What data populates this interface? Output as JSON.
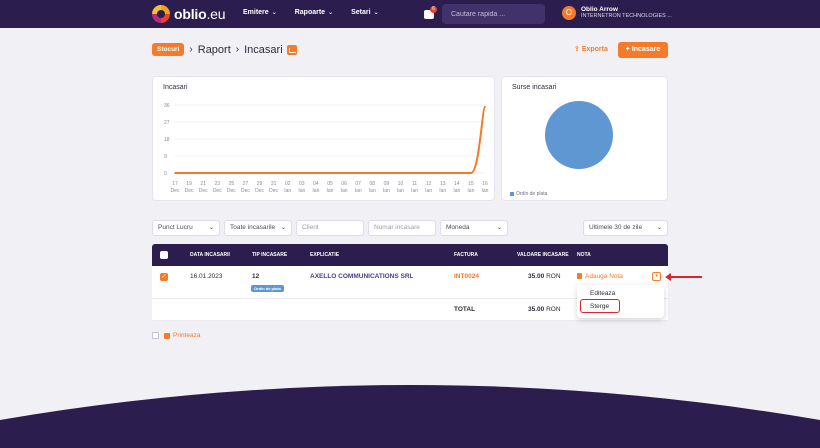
{
  "brand": {
    "name_main": "oblio",
    "name_suffix": ".eu"
  },
  "nav": {
    "items": [
      {
        "label": "Emitere"
      },
      {
        "label": "Rapoarte"
      },
      {
        "label": "Setari"
      }
    ],
    "notifications_count": "6",
    "search_placeholder": "Cautare rapida ..."
  },
  "user": {
    "initial": "O",
    "name": "Oblio Arrow",
    "company": "INTERNETRON TECHNOLOGIES ..."
  },
  "breadcrumb": {
    "stocuri": "Stocuri",
    "level1": "Raport",
    "level2": "Incasari"
  },
  "toolbar": {
    "export_label": "Exporta",
    "add_label": "Incasare"
  },
  "charts": {
    "line_title": "Incasari",
    "pie_title": "Surse incasari",
    "pie_slice_label": "100.0%",
    "pie_legend": "Ordin de plata"
  },
  "chart_data": [
    {
      "type": "line",
      "title": "Incasari",
      "y_ticks": [
        0,
        9,
        18,
        27,
        36
      ],
      "ylim": [
        0,
        36
      ],
      "x_tick_labels": [
        [
          "17",
          "Dec"
        ],
        [
          "19",
          "Dec"
        ],
        [
          "21",
          "Dec"
        ],
        [
          "23",
          "Dec"
        ],
        [
          "25",
          "Dec"
        ],
        [
          "27",
          "Dec"
        ],
        [
          "29",
          "Dec"
        ],
        [
          "31",
          "Dec"
        ],
        [
          "02",
          "Ian"
        ],
        [
          "03",
          "Ian"
        ],
        [
          "04",
          "Ian"
        ],
        [
          "05",
          "Ian"
        ],
        [
          "06",
          "Ian"
        ],
        [
          "07",
          "Ian"
        ],
        [
          "08",
          "Ian"
        ],
        [
          "09",
          "Ian"
        ],
        [
          "10",
          "Ian"
        ],
        [
          "11",
          "Ian"
        ],
        [
          "12",
          "Ian"
        ],
        [
          "13",
          "Ian"
        ],
        [
          "14",
          "Ian"
        ],
        [
          "15",
          "Ian"
        ],
        [
          "16",
          "Ian"
        ]
      ],
      "series": [
        {
          "values": [
            0,
            0,
            0,
            0,
            0,
            0,
            0,
            0,
            0,
            0,
            0,
            0,
            0,
            0,
            0,
            0,
            0,
            0,
            0,
            0,
            0,
            0,
            35
          ]
        }
      ],
      "grid": true,
      "color": "#f47b2a"
    },
    {
      "type": "pie",
      "title": "Surse incasari",
      "slices": [
        {
          "label": "Ordin de plata",
          "value": 100.0
        }
      ],
      "color": "#5f97d3"
    }
  ],
  "filters": {
    "punct_lucru": "Punct Lucru",
    "incasari": "Toate incasarile",
    "client_placeholder": "Client",
    "numar_placeholder": "Numar incasare",
    "moneda": "Moneda",
    "period": "Ultimele 30 de zile"
  },
  "table": {
    "headers": {
      "data": "DATA INCASARII",
      "tip": "TIP INCASARE",
      "explicatie": "EXPLICATIE",
      "factura": "FACTURA",
      "valoare": "VALOARE INCASARE",
      "nota": "NOTA"
    },
    "row": {
      "data": "16.01.2023",
      "tip": "12",
      "tip_badge": "Ordin de plata",
      "explicatie": "AXELLO COMMUNICATIONS SRL",
      "factura": "INT0024",
      "valoare": "35.00",
      "moneda": "RON",
      "nota": "Adauga Nota"
    },
    "total": {
      "label": "TOTAL",
      "valoare": "35.00",
      "moneda": "RON"
    }
  },
  "dropdown": {
    "edit": "Editeaza",
    "delete": "Sterge"
  },
  "print_label": "Printeaza",
  "colors": {
    "brand_dark": "#2b1e4f",
    "accent": "#f47b2a",
    "pie": "#5f97d3",
    "highlight": "#d8262c"
  }
}
